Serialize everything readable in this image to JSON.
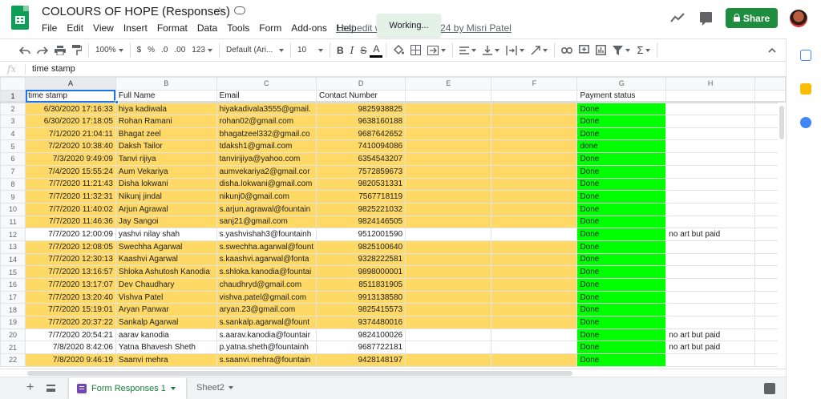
{
  "doc": {
    "title": "COLOURS OF HOPE (Responses)",
    "last_edit": "Last edit was on August 24 by Misri Patel",
    "toast": "Working..."
  },
  "menu": [
    "File",
    "Edit",
    "View",
    "Insert",
    "Format",
    "Data",
    "Tools",
    "Form",
    "Add-ons",
    "Help"
  ],
  "header_actions": {
    "share_label": "Share"
  },
  "toolbar": {
    "zoom": "100%",
    "currency": "$",
    "percent": "%",
    "dec_less": ".0",
    "dec_more": ".00",
    "more_formats": "123",
    "font": "Default (Ari...",
    "font_size": "10",
    "bold": "B",
    "italic": "I",
    "strike": "S",
    "text_color": "A",
    "functions": "Σ"
  },
  "formula_bar": {
    "fx": "fx",
    "value": "time stamp"
  },
  "columns": [
    "A",
    "B",
    "C",
    "D",
    "E",
    "F",
    "G",
    "H"
  ],
  "header_row": {
    "num": "1",
    "cells": [
      "time stamp",
      "Full Name",
      "Email",
      "Contact Number",
      "",
      "",
      "Payment status",
      ""
    ]
  },
  "rows": [
    {
      "num": "2",
      "fill": "yellow",
      "ts": "6/30/2020 17:16:33",
      "name": "hiya kadiwala",
      "email": "hiyakadivala3555@gmail.",
      "contact": "9825938825",
      "status": "Done",
      "note": ""
    },
    {
      "num": "3",
      "fill": "yellow",
      "ts": "6/30/2020 17:18:05",
      "name": "Rohan Ramani",
      "email": "rohan02@gmail.com",
      "contact": "9638160188",
      "status": "Done",
      "note": ""
    },
    {
      "num": "4",
      "fill": "yellow",
      "ts": "7/1/2020 21:04:11",
      "name": "Bhagat zeel",
      "email": "bhagatzeel332@gmail.co",
      "contact": "9687642652",
      "status": "Done",
      "note": ""
    },
    {
      "num": "5",
      "fill": "yellow",
      "ts": "7/2/2020 10:38:40",
      "name": "Daksh Tailor",
      "email": "tdaksh1@gmail.com",
      "contact": "7410094086",
      "status": "done",
      "note": ""
    },
    {
      "num": "6",
      "fill": "yellow",
      "ts": "7/3/2020 9:49:09",
      "name": "Tanvi rijiya",
      "email": "tanvirijiya@yahoo.com",
      "contact": "6354543207",
      "status": "Done",
      "note": ""
    },
    {
      "num": "7",
      "fill": "yellow",
      "ts": "7/4/2020 15:55:24",
      "name": "Aum Vekariya",
      "email": "aumvekariya2@gmail.cor",
      "contact": "7572859673",
      "status": "Done",
      "note": ""
    },
    {
      "num": "8",
      "fill": "yellow",
      "ts": "7/7/2020 11:21:43",
      "name": "Disha lokwani",
      "email": "disha.lokwani@gmail.com",
      "contact": "9820531331",
      "status": "Done",
      "note": ""
    },
    {
      "num": "9",
      "fill": "yellow",
      "ts": "7/7/2020 11:32:31",
      "name": "Nikunj jindal",
      "email": "nikunj0@gmail.com",
      "contact": "7567718119",
      "status": "Done",
      "note": ""
    },
    {
      "num": "10",
      "fill": "yellow",
      "ts": "7/7/2020 11:40:02",
      "name": "Arjun Agrawal",
      "email": "s.arjun.agrawal@fountain",
      "contact": "9825221032",
      "status": "Done",
      "note": ""
    },
    {
      "num": "11",
      "fill": "yellow",
      "ts": "7/7/2020 11:46:36",
      "name": "Jay Sangoi",
      "email": "sanj21@gmail.com",
      "contact": "9824146505",
      "status": "Done",
      "note": ""
    },
    {
      "num": "12",
      "fill": "white",
      "ts": "7/7/2020 12:00:09",
      "name": "yashvi nilay shah",
      "email": "s.yashvishah3@fountainh",
      "contact": "9512001590",
      "status": "Done",
      "note": "no art but paid"
    },
    {
      "num": "13",
      "fill": "yellow",
      "ts": "7/7/2020 12:08:05",
      "name": "Swechha Agarwal",
      "email": "s.swechha.agarwal@fount",
      "contact": "9825100640",
      "status": "Done",
      "note": ""
    },
    {
      "num": "14",
      "fill": "yellow",
      "ts": "7/7/2020 12:30:13",
      "name": "Kaashvi Agarwal",
      "email": "s.kaashvi.agarwal@fonta",
      "contact": "9328222581",
      "status": "Done",
      "note": ""
    },
    {
      "num": "15",
      "fill": "yellow",
      "ts": "7/7/2020 13:16:57",
      "name": "Shloka Ashutosh Kanodia",
      "email": "s.shloka.kanodia@fountai",
      "contact": "9898000001",
      "status": "Done",
      "note": ""
    },
    {
      "num": "16",
      "fill": "yellow",
      "ts": "7/7/2020 13:17:07",
      "name": "Dev Chaudhary",
      "email": "chaudhryd@gmail.com",
      "contact": "8511831905",
      "status": "Done",
      "note": ""
    },
    {
      "num": "17",
      "fill": "yellow",
      "ts": "7/7/2020 13:20:40",
      "name": "Vishva Patel",
      "email": "vishva.patel@gmail.com",
      "contact": "9913138580",
      "status": "Done",
      "note": ""
    },
    {
      "num": "18",
      "fill": "yellow",
      "ts": "7/7/2020 15:19:01",
      "name": "Aryan Panwar",
      "email": "aryan.23@gmail.com",
      "contact": "9825415573",
      "status": "Done",
      "note": ""
    },
    {
      "num": "19",
      "fill": "yellow",
      "ts": "7/7/2020 20:37:22",
      "name": "Sankalp Agarwal",
      "email": "s.sankalp.agarwal@fount",
      "contact": "9374480016",
      "status": "Done",
      "note": ""
    },
    {
      "num": "20",
      "fill": "white",
      "ts": "7/7/2020 20:54:21",
      "name": "aarav kanodia",
      "email": "s.aarav.kanodia@fountair",
      "contact": "9824100026",
      "status": "Done",
      "note": "no art but paid"
    },
    {
      "num": "21",
      "fill": "white",
      "ts": "7/8/2020 8:42:06",
      "name": "Yatna Bhavesh Sheth",
      "email": "p.yatna.sheth@fountainh",
      "contact": "9687722181",
      "status": "Done",
      "note": "no art but paid"
    },
    {
      "num": "22",
      "fill": "yellow",
      "ts": "7/8/2020 9:46:19",
      "name": "Saanvi mehra",
      "email": "s.saanvi.mehra@fountain",
      "contact": "9428148197",
      "status": "Done",
      "note": ""
    }
  ],
  "colors": {
    "yellow_fill": "#ffd966",
    "green_fill": "#00ff00",
    "accent": "#1a73e8",
    "share_green": "#1e8e3e"
  },
  "sheets": [
    {
      "label": "Form Responses 1",
      "active": true
    },
    {
      "label": "Sheet2",
      "active": false
    }
  ],
  "icons": [
    "star-icon",
    "cloud-icon",
    "trend-icon",
    "comment-icon",
    "lock-icon",
    "avatar",
    "form-icon",
    "explore-icon"
  ]
}
